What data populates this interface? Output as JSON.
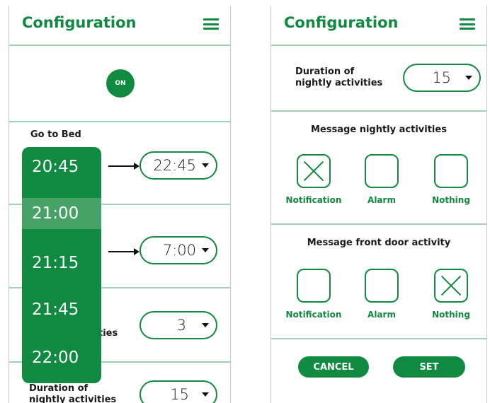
{
  "left_screen": {
    "title": "Configuration",
    "toggle_label": "ON",
    "go_to_bed_label": "Go to Bed",
    "go_to_bed_value": "22:45",
    "wake_value": "7:00",
    "activities_partial_label": "ties",
    "activities_value": "3",
    "duration_label_line1": "Duration of",
    "duration_label_line2": "nightly activities",
    "duration_value": "15",
    "time_picker": {
      "options": [
        "20:45",
        "21:00",
        "21:15",
        "21:45",
        "22:00"
      ],
      "selected": "21:00"
    }
  },
  "right_screen": {
    "title": "Configuration",
    "duration_label_line1": "Duration of",
    "duration_label_line2": "nightly activities",
    "duration_value": "15",
    "nightly_heading": "Message nightly activities",
    "nightly_options": [
      {
        "label": "Notification",
        "checked": true
      },
      {
        "label": "Alarm",
        "checked": false
      },
      {
        "label": "Nothing",
        "checked": false
      }
    ],
    "front_door_heading": "Message front door activity",
    "front_door_options": [
      {
        "label": "Notification",
        "checked": false
      },
      {
        "label": "Alarm",
        "checked": false
      },
      {
        "label": "Nothing",
        "checked": true
      }
    ],
    "cancel_label": "CANCEL",
    "set_label": "SET"
  },
  "colors": {
    "accent": "#118a41",
    "picker_selected": "#46a266",
    "divider": "#9fd2b0"
  },
  "icons": [
    "menu-icon",
    "arrow-right-icon",
    "caret-down-icon",
    "check-x-icon"
  ]
}
